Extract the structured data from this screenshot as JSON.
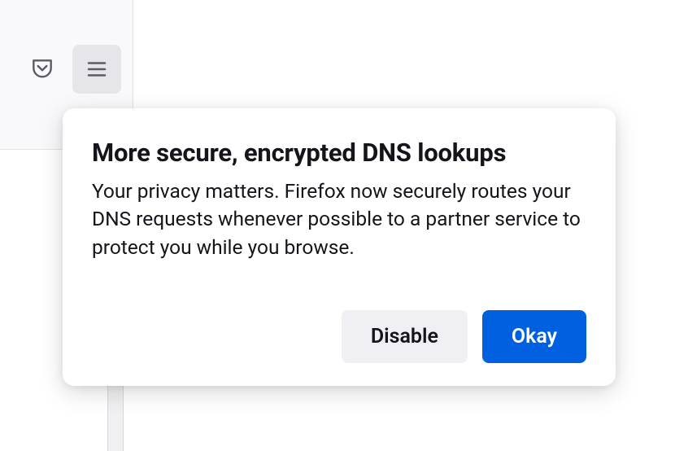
{
  "toolbar": {
    "pocket_icon": "pocket-icon",
    "menu_icon": "menu-icon"
  },
  "dialog": {
    "title": "More secure, encrypted DNS lookups",
    "body": "Your privacy matters. Firefox now securely routes your DNS requests whenever possible to a partner service to protect you while you browse.",
    "disable_label": "Disable",
    "okay_label": "Okay"
  }
}
